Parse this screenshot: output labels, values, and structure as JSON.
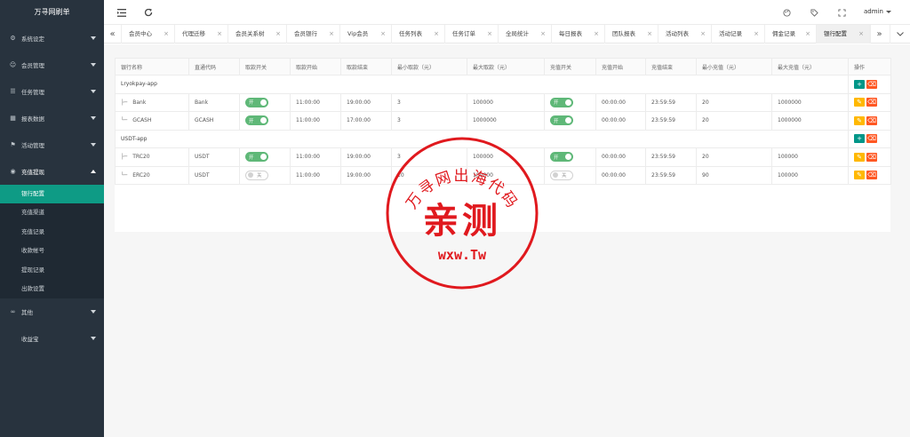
{
  "brand": "万寻网刷单",
  "sidebar": {
    "menus": [
      {
        "label": "系统设定",
        "icon": "gear-icon",
        "glyph": "⚙"
      },
      {
        "label": "会员管理",
        "icon": "user-icon",
        "glyph": "☺"
      },
      {
        "label": "任务管理",
        "icon": "list-icon",
        "glyph": "☰"
      },
      {
        "label": "报表数据",
        "icon": "report-icon",
        "glyph": "▦"
      },
      {
        "label": "活动管理",
        "icon": "activity-icon",
        "glyph": "⚑"
      },
      {
        "label": "充值提现",
        "icon": "wallet-icon",
        "glyph": "◉"
      }
    ],
    "submenu": [
      "银行配置",
      "充值渠道",
      "充值记录",
      "收款帐号",
      "提现记录",
      "出款设置"
    ],
    "bottom": [
      {
        "label": "其他",
        "icon": "link-icon",
        "glyph": "∞"
      },
      {
        "label": "收益宝",
        "icon": "coin-icon",
        "glyph": ""
      }
    ]
  },
  "header": {
    "user": "admin"
  },
  "tabs": [
    "会员中心",
    "代理迁移",
    "会员关系树",
    "会员银行",
    "Vip会员",
    "任务列表",
    "任务订单",
    "全局统计",
    "每日报表",
    "团队报表",
    "活动列表",
    "活动记录",
    "佣金记录",
    "银行配置"
  ],
  "table": {
    "headers": [
      "银行名称",
      "直通代码",
      "取款开关",
      "取款开始",
      "取款结束",
      "最小取款（元）",
      "最大取款（元）",
      "充值开关",
      "充值开始",
      "充值结束",
      "最小充值（元）",
      "最大充值（元）",
      "操作"
    ],
    "groups": [
      {
        "name": "Lryokpay-app",
        "rows": [
          {
            "name": "Bank",
            "code": "Bank",
            "wd_on": "开",
            "wd_start": "11:00:00",
            "wd_end": "19:00:00",
            "wd_min": "3",
            "wd_max": "100000",
            "dep_on": "开",
            "dep_start": "00:00:00",
            "dep_end": "23:59:59",
            "dep_min": "20",
            "dep_max": "1000000"
          },
          {
            "name": "GCASH",
            "code": "GCASH",
            "wd_on": "开",
            "wd_start": "11:00:00",
            "wd_end": "17:00:00",
            "wd_min": "3",
            "wd_max": "1000000",
            "dep_on": "开",
            "dep_start": "00:00:00",
            "dep_end": "23:59:59",
            "dep_min": "20",
            "dep_max": "1000000"
          }
        ]
      },
      {
        "name": "USDT-app",
        "rows": [
          {
            "name": "TRC20",
            "code": "USDT",
            "wd_on": "开",
            "wd_start": "11:00:00",
            "wd_end": "19:00:00",
            "wd_min": "3",
            "wd_max": "100000",
            "dep_on": "开",
            "dep_start": "00:00:00",
            "dep_end": "23:59:59",
            "dep_min": "20",
            "dep_max": "100000"
          },
          {
            "name": "ERC20",
            "code": "USDT",
            "wd_on": "关",
            "wd_start": "11:00:00",
            "wd_end": "19:00:00",
            "wd_min": "10",
            "wd_max": "100000",
            "dep_on": "关",
            "dep_start": "00:00:00",
            "dep_end": "23:59:59",
            "dep_min": "90",
            "dep_max": "100000"
          }
        ]
      }
    ]
  },
  "stamp": {
    "arc": "万寻网出海代码",
    "center": "亲测",
    "bottom": "wxw.Tw",
    "color": "#e0191e"
  },
  "colors": {
    "sidebar": "#28333e",
    "active": "#0e9b85",
    "toggle_on": "#5fb878",
    "btn_add": "#009688",
    "btn_del": "#ff5722",
    "btn_edit": "#ffb800"
  }
}
